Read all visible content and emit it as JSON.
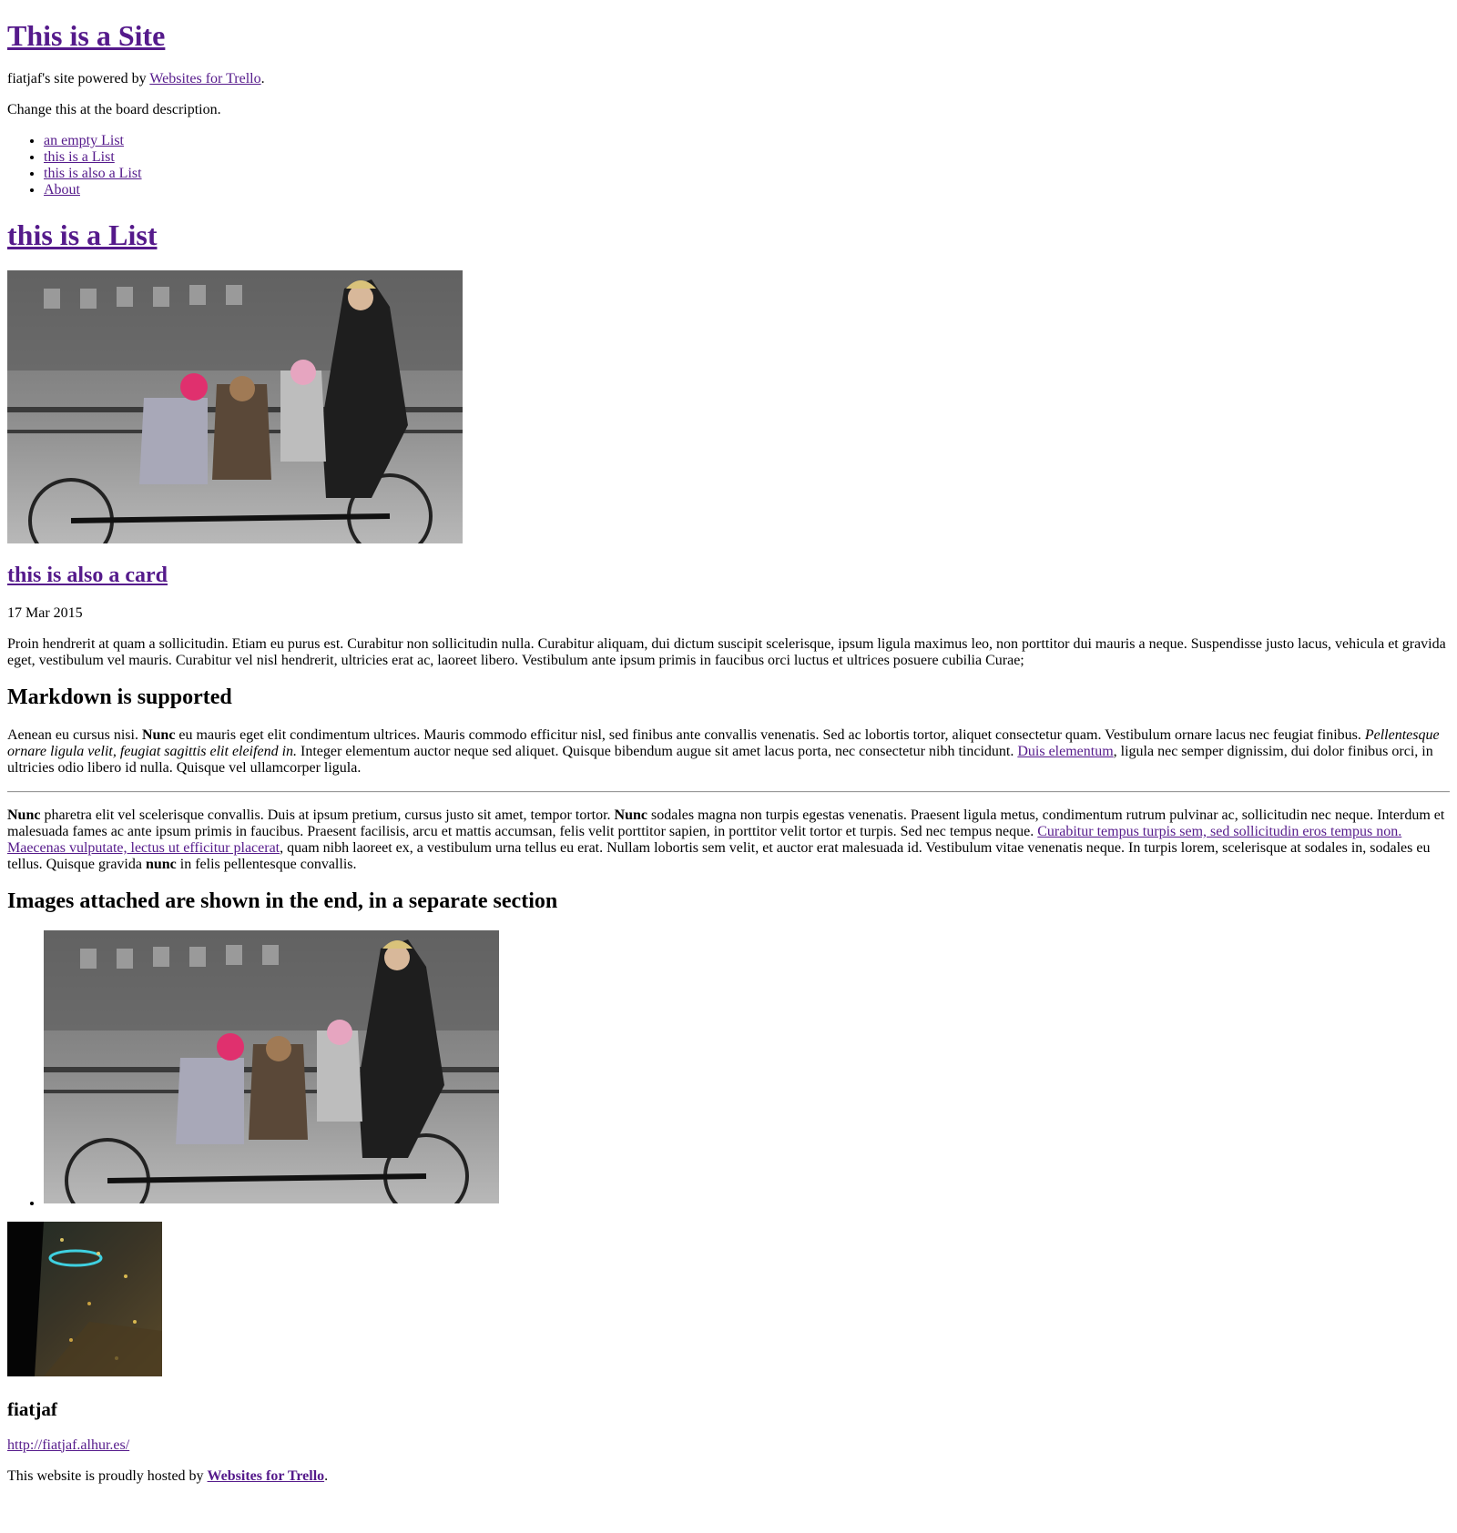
{
  "site": {
    "title": "This is a Site",
    "powered_prefix": "fiatjaf's site powered by ",
    "powered_link": "Websites for Trello",
    "powered_suffix": ".",
    "description": "Change this at the board description."
  },
  "nav": {
    "items": [
      {
        "label": "an empty List"
      },
      {
        "label": "this is a List"
      },
      {
        "label": "this is also a List"
      },
      {
        "label": "About"
      }
    ]
  },
  "list": {
    "title": "this is a List"
  },
  "card": {
    "title": "this is also a card",
    "date": "17 Mar 2015",
    "intro": "Proin hendrerit at quam a sollicitudin. Etiam eu purus est. Curabitur non sollicitudin nulla. Curabitur aliquam, dui dictum suscipit scelerisque, ipsum ligula maximus leo, non porttitor dui mauris a neque. Suspendisse justo lacus, vehicula et gravida eget, vestibulum vel mauris. Curabitur vel nisl hendrerit, ultricies erat ac, laoreet libero. Vestibulum ante ipsum primis in faucibus orci luctus et ultrices posuere cubilia Curae;",
    "markdown_heading": "Markdown is supported",
    "para1": {
      "t1": "Aenean eu cursus nisi. ",
      "b1": "Nunc",
      "t2": " eu mauris eget elit condimentum ultrices. Mauris commodo efficitur nisl, sed finibus ante convallis venenatis. Sed ac lobortis tortor, aliquet consectetur quam. Vestibulum ornare lacus nec feugiat finibus. ",
      "i1": "Pellentesque ornare ligula velit, feugiat sagittis elit eleifend in.",
      "t3": " Integer elementum auctor neque sed aliquet. Quisque bibendum augue sit amet lacus porta, nec consectetur nibh tincidunt. ",
      "link": "Duis elementum",
      "t4": ", ligula nec semper dignissim, dui dolor finibus orci, in ultricies odio libero id nulla. Quisque vel ullamcorper ligula."
    },
    "para2": {
      "b1": "Nunc",
      "t1": " pharetra elit vel scelerisque convallis. Duis at ipsum pretium, cursus justo sit amet, tempor tortor. ",
      "b2": "Nunc",
      "t2": " sodales magna non turpis egestas venenatis. Praesent ligula metus, condimentum rutrum pulvinar ac, sollicitudin nec neque. Interdum et malesuada fames ac ante ipsum primis in faucibus. Praesent facilisis, arcu et mattis accumsan, felis velit porttitor sapien, in porttitor velit tortor et turpis. Sed nec tempus neque. ",
      "link": "Curabitur tempus turpis sem, sed sollicitudin eros tempus non. Maecenas vulputate, lectus ut efficitur placerat",
      "t3": ", quam nibh laoreet ex, a vestibulum urna tellus eu erat. Nullam lobortis sem velit, et auctor erat malesuada id. Vestibulum vitae venenatis neque. In turpis lorem, scelerisque at sodales in, sodales eu tellus. Quisque gravida ",
      "b3": "nunc",
      "t4": " in felis pellentesque convallis."
    },
    "images_heading": "Images attached are shown in the end, in a separate section"
  },
  "author": {
    "name": "fiatjaf",
    "url": "http://fiatjaf.alhur.es/"
  },
  "footer": {
    "prefix": "This website is proudly hosted by ",
    "link": "Websites for Trello",
    "suffix": "."
  },
  "colors": {
    "link": "#551a8b",
    "text": "#000000",
    "background": "#ffffff"
  }
}
